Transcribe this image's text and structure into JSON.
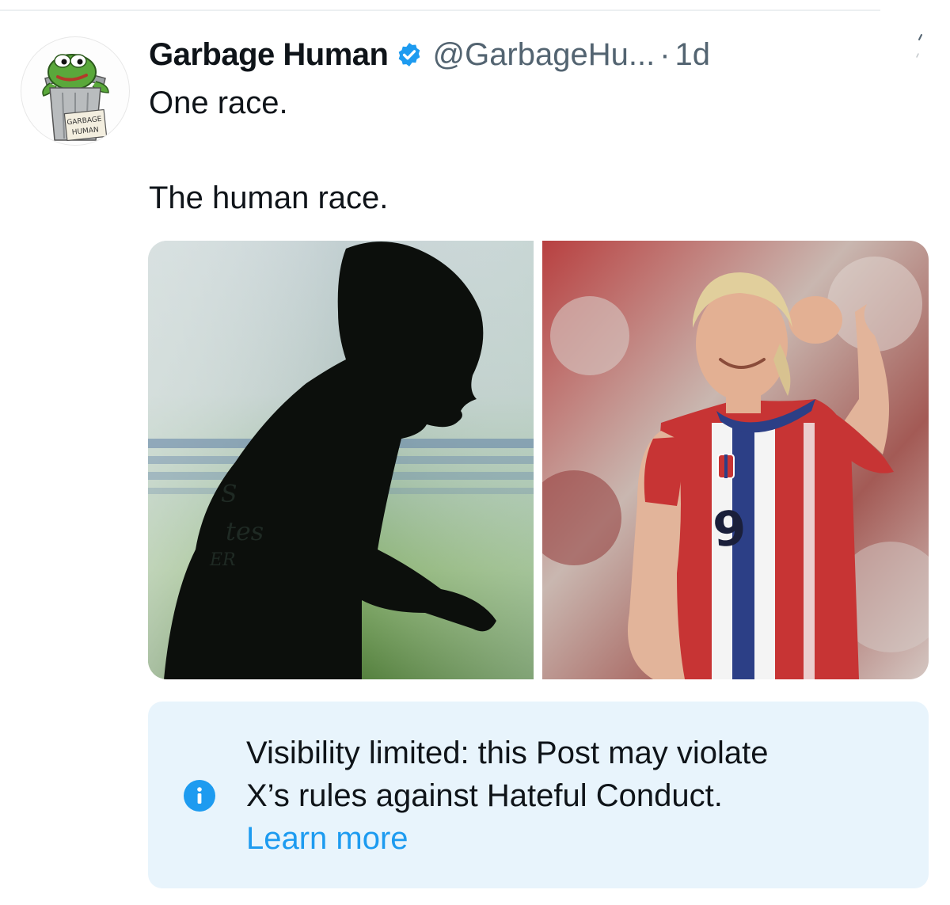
{
  "post": {
    "author_name": "Garbage Human",
    "handle": "@GarbageHu...",
    "separator": "·",
    "time": "1d",
    "text_line1": "One race.",
    "text_line2": "The human race."
  },
  "avatar": {
    "sign_text_1": "GARBAGE",
    "sign_text_2": "HUMAN"
  },
  "media": {
    "left_image": "silhouette-of-football-player",
    "right_image": "football-player-in-red-white-blue-jersey-celebrating",
    "jersey_number": "9",
    "jersey_partial_text": [
      "S",
      "tes",
      "ER"
    ]
  },
  "notice": {
    "line1": "Visibility limited: this Post may violate",
    "line2": "X’s rules against Hateful Conduct.",
    "link": "Learn more"
  },
  "icons": {
    "verified": "verified-badge-icon",
    "info": "info-icon",
    "more": "more-options-icon"
  },
  "colors": {
    "accent": "#1d9bf0",
    "secondary_text": "#536471",
    "notice_bg": "#e8f4fc"
  }
}
